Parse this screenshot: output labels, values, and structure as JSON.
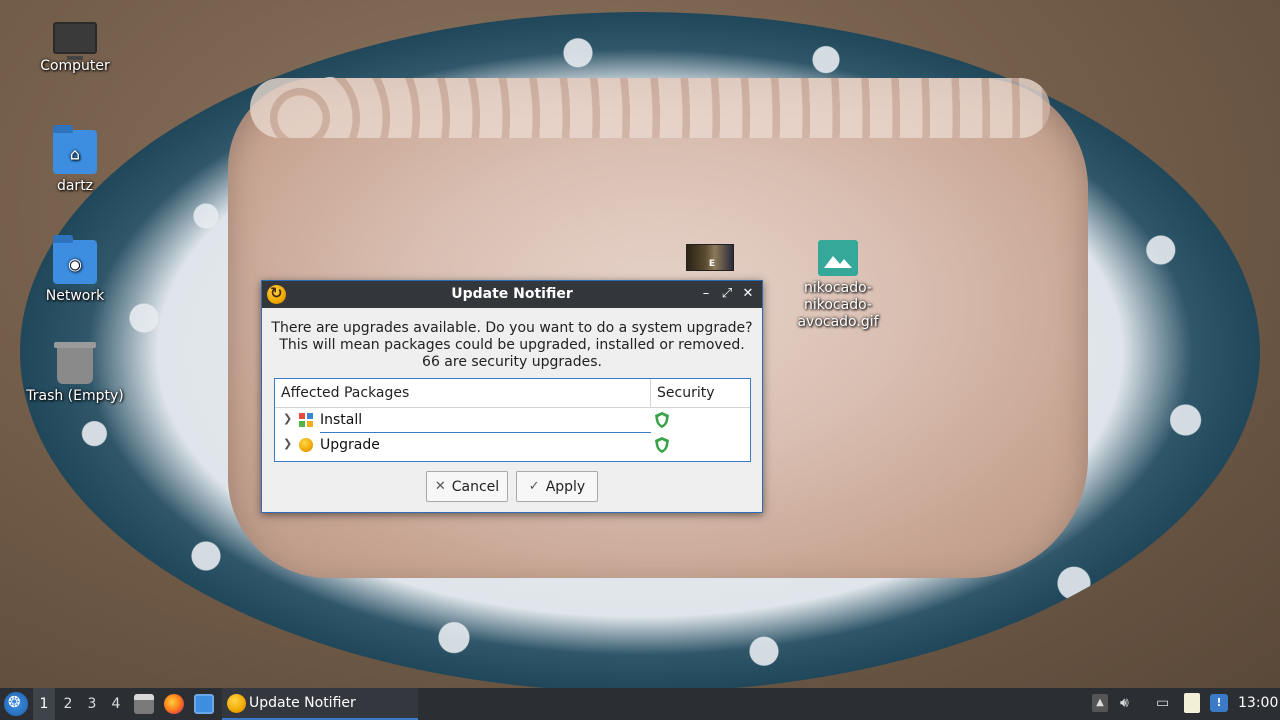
{
  "desktop": {
    "icons": [
      {
        "label": "Computer",
        "icon": "computer-icon"
      },
      {
        "label": "dartz",
        "icon": "home-folder-icon"
      },
      {
        "label": "Network",
        "icon": "network-icon"
      },
      {
        "label": "Trash (Empty)",
        "icon": "trash-icon"
      }
    ],
    "thumb_badge": "E",
    "gif_label": "nikocado-nikocado-avocado.gif",
    "gif_label_lines": [
      "nikocado-",
      "nikocado-",
      "avocado.gif"
    ]
  },
  "dialog": {
    "title": "Update Notifier",
    "message_lines": [
      "There are upgrades available. Do you want to do a system upgrade?",
      "This will mean packages could be upgraded, installed or removed.",
      "66 are security upgrades."
    ],
    "columns": {
      "packages": "Affected Packages",
      "security": "Security"
    },
    "rows": [
      {
        "label": "Install",
        "icon": "install-icon",
        "security": "shield-icon"
      },
      {
        "label": "Upgrade",
        "icon": "upgrade-icon",
        "security": "shield-icon"
      }
    ],
    "buttons": {
      "cancel": "Cancel",
      "apply": "Apply"
    },
    "window_controls": {
      "minimize": "–",
      "maximize": "⤢",
      "close": "✕"
    }
  },
  "taskbar": {
    "workspaces": [
      "1",
      "2",
      "3",
      "4"
    ],
    "active_workspace": "1",
    "task": "Update Notifier",
    "clock": "13:00"
  },
  "colors": {
    "accent": "#3b7ac6",
    "titlebar": "#33363b",
    "taskbar": "#2b2e33",
    "shield": "#3aa34a"
  }
}
